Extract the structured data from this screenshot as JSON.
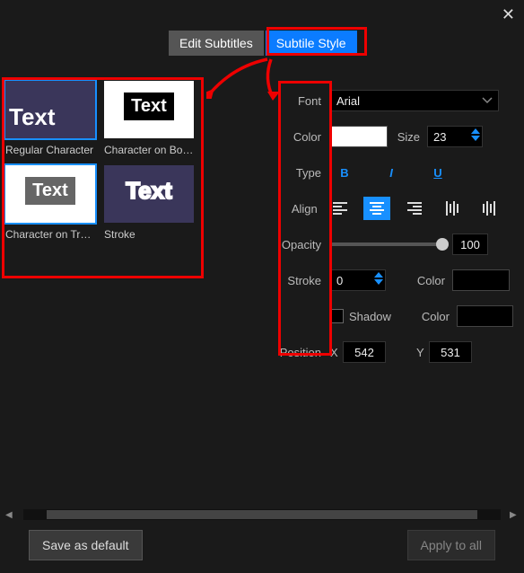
{
  "close_icon": "✕",
  "tabs": {
    "edit": "Edit Subtitles",
    "style": "Subtile Style"
  },
  "presets": [
    {
      "text": "Text",
      "label": "Regular Character"
    },
    {
      "text": "Text",
      "label": "Character on Bot..."
    },
    {
      "text": "Text",
      "label": "Character on Tra..."
    },
    {
      "text": "Text",
      "label": "Stroke"
    }
  ],
  "labels": {
    "font": "Font",
    "color": "Color",
    "size": "Size",
    "type": "Type",
    "align": "Align",
    "opacity": "Opacity",
    "stroke": "Stroke",
    "stroke_color": "Color",
    "shadow": "Shadow",
    "shadow_color": "Color",
    "position": "Position",
    "x": "X",
    "y": "Y"
  },
  "values": {
    "font": "Arial",
    "font_size": "23",
    "opacity": "100",
    "stroke": "0",
    "pos_x": "542",
    "pos_y": "531"
  },
  "type_buttons": {
    "bold": "B",
    "italic": "I",
    "underline": "U"
  },
  "footer": {
    "save": "Save as default",
    "apply": "Apply to all"
  },
  "colors": {
    "text": "#ffffff",
    "stroke": "#000000",
    "shadow": "#000000"
  }
}
